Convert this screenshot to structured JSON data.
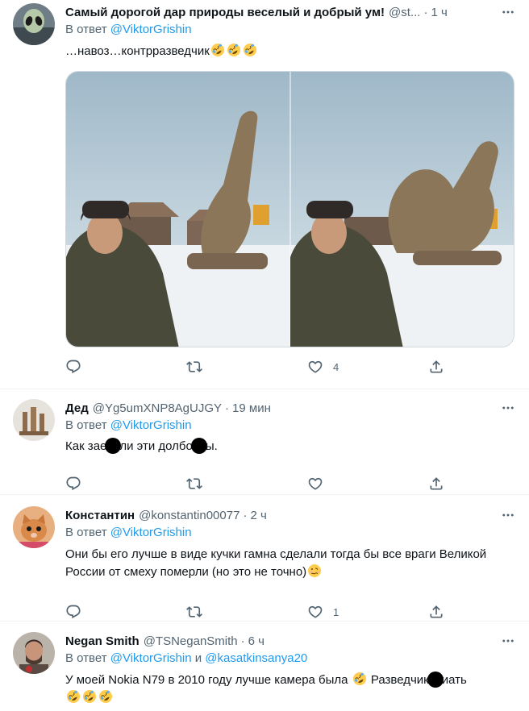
{
  "tweets": [
    {
      "name": "Самый дорогой дар природы веселый и добрый ум!",
      "handle": "@st...",
      "time": "1 ч",
      "reply_prefix": "В ответ",
      "reply_to": "@ViktorGrishin",
      "text": "…навоз…контрразведчик",
      "emoji": [
        "rofl",
        "rofl",
        "rofl"
      ],
      "actions": {
        "reply": "",
        "retweet": "",
        "like": "4",
        "share": ""
      },
      "media": {
        "alt": "Фото: мужчина в шапке-ушанке рядом с деревянной скульптурой зимой"
      }
    },
    {
      "name": "Дед",
      "handle": "@Yg5umXNP8AgUJGY",
      "time": "19 мин",
      "reply_prefix": "В ответ",
      "reply_to": "@ViktorGrishin",
      "text_parts": [
        "Как зае",
        "ли эти долбо",
        "ы."
      ],
      "actions": {
        "reply": "",
        "retweet": "",
        "like": "",
        "share": ""
      }
    },
    {
      "name": "Константин",
      "handle": "@konstantin00077",
      "time": "2 ч",
      "reply_prefix": "В ответ",
      "reply_to": "@ViktorGrishin",
      "text": "Они бы его лучше в виде кучки гамна сделали тогда бы все враги Великой России от смеху померли (но это не точно)",
      "actions": {
        "reply": "",
        "retweet": "",
        "like": "1",
        "share": ""
      }
    },
    {
      "name": "Negan Smith",
      "handle": "@TSNeganSmith",
      "time": "6 ч",
      "reply_prefix": "В ответ",
      "reply_to": "@ViktorGrishin",
      "reply_and": "и",
      "reply_to_2": "@kasatkinsanya20",
      "text_parts": [
        "У моей Nokia N79 в 2010 году лучше камера была",
        "Разведчик",
        "иать"
      ],
      "actions": {
        "reply": "",
        "retweet": "",
        "like": "",
        "share": ""
      }
    }
  ],
  "colors": {
    "accent": "#1d9bf0",
    "secondary_text": "#536471",
    "primary_text": "#0f1419",
    "divider": "#eff3f4"
  },
  "icons": [
    "reply-icon",
    "retweet-icon",
    "like-icon",
    "share-icon",
    "more-icon",
    "rofl-emoji",
    "woozy-emoji"
  ]
}
